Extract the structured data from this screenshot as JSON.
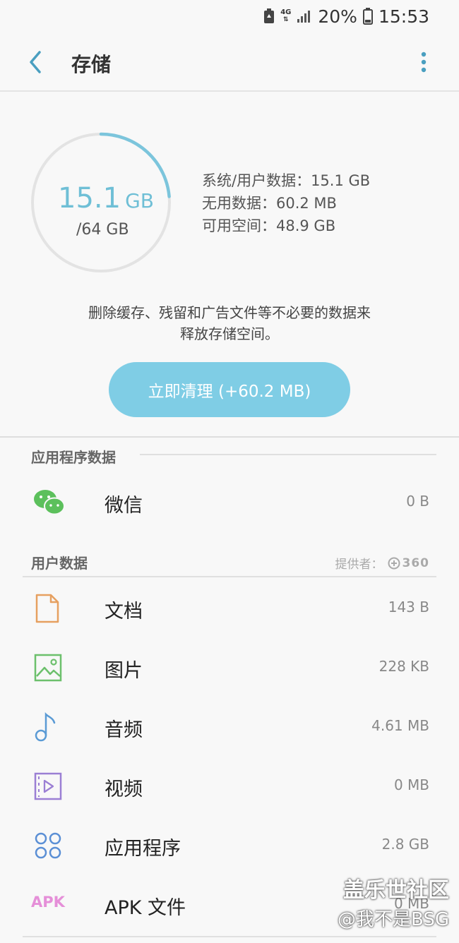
{
  "status_bar": {
    "network": "4G",
    "battery": "20%",
    "time": "15:53"
  },
  "app_bar": {
    "title": "存储"
  },
  "storage": {
    "used_value": "15.1",
    "used_unit": "GB",
    "total": "/64 GB",
    "used_fraction": 0.236,
    "info_lines": [
      "系统/用户数据：15.1 GB",
      "无用数据：60.2 MB",
      "可用空间：48.9 GB"
    ],
    "description_line1": "删除缓存、残留和广告文件等不必要的数据来",
    "description_line2": "释放存储空间。",
    "clean_button": "立即清理 (+60.2 MB)"
  },
  "app_data_section": {
    "title": "应用程序数据",
    "items": [
      {
        "label": "微信",
        "value": "0 B",
        "icon": "wechat-icon"
      }
    ]
  },
  "user_data_section": {
    "title": "用户数据",
    "provider_label": "提供者：",
    "provider_logo": "360",
    "items": [
      {
        "label": "文档",
        "value": "143 B",
        "icon": "document-icon"
      },
      {
        "label": "图片",
        "value": "228 KB",
        "icon": "image-icon"
      },
      {
        "label": "音频",
        "value": "4.61 MB",
        "icon": "music-note-icon"
      },
      {
        "label": "视频",
        "value": "0 MB",
        "icon": "video-icon"
      },
      {
        "label": "应用程序",
        "value": "2.8 GB",
        "icon": "apps-grid-icon"
      },
      {
        "label": "APK 文件",
        "value": "0 MB",
        "icon": "apk-icon",
        "icon_text": "APK"
      }
    ]
  },
  "watermark": {
    "line1": "盖乐世社区",
    "line2": "@我不是BSG"
  },
  "colors": {
    "accent": "#6fbfd6",
    "button": "#7fcde5",
    "back": "#4a9fc0"
  }
}
